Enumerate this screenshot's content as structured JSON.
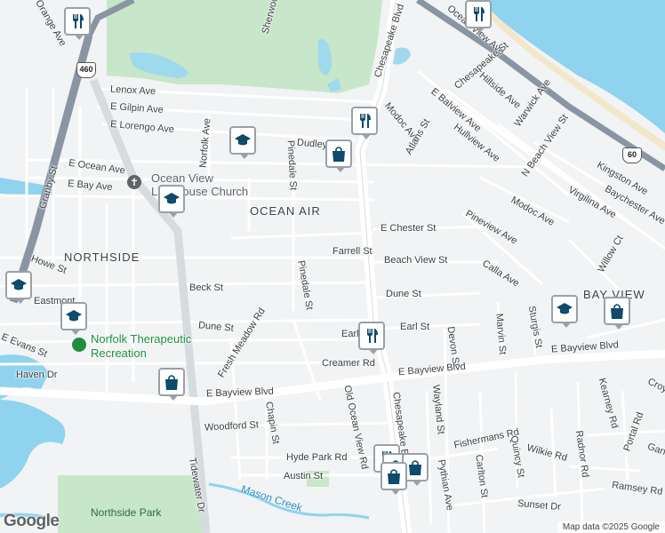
{
  "map": {
    "attribution": "Map data ©2025 Google",
    "logo": "Google",
    "colors": {
      "water": "#8fd3ee",
      "park": "#c8e6c9",
      "road": "#ffffff",
      "highway": "#8a95a3",
      "background": "#f1f3f4",
      "pin_icon": "#0d4a6b"
    }
  },
  "areas": {
    "ocean_air": "OCEAN AIR",
    "northside": "NORTHSIDE",
    "bay_view": "BAY VIEW"
  },
  "pois": {
    "church": "Ocean View Lighthouse Church",
    "church_line1": "Ocean View",
    "church_line2": "Lighthouse Church",
    "therapy_line1": "Norfolk Therapeutic",
    "therapy_line2": "Recreation",
    "park": "Northside Park",
    "creek": "Mason Creek"
  },
  "shields": {
    "us460": "460",
    "us60": "60"
  },
  "streets": {
    "orange": "Orange Ave",
    "sherwood": "Sherwood",
    "chesapeake_blvd_n": "Chesapeake Blvd",
    "ocean_view": "Ocean View Ave",
    "lenox": "Lenox Ave",
    "gilpin": "E Gilpin Ave",
    "lorengo": "E Lorengo Ave",
    "norfolk": "Norfolk Ave",
    "dudley": "Dudley",
    "pinedale_n": "Pinedale St",
    "granby": "Granby St",
    "e_ocean": "E Ocean Ave",
    "e_bay": "E Bay Ave",
    "chesapeake_st": "Chesapeake St",
    "hillside": "Hillside Ave",
    "warwick": "Warwick Ave",
    "e_balview": "E Balview Ave",
    "modoc_n": "Modoc Ave",
    "atlans": "Atlans St",
    "hullview": "Hullview Ave",
    "n_beach_view": "N Beach View St",
    "kingston": "Kingston Ave",
    "baychester": "Baychester Ave",
    "virgilina": "Virgilina Ave",
    "modoc_s": "Modoc Ave",
    "e_chester": "E Chester St",
    "pineview": "Pineview Ave",
    "willow": "Willow Ct",
    "farrell": "Farrell St",
    "beach_view": "Beach View St",
    "calla": "Calla Ave",
    "howe": "Howe St",
    "beck": "Beck St",
    "pinedale_s": "Pinedale St",
    "dune_e": "Dune St",
    "dune_w": "Dune St",
    "eastmont": "Eastmont",
    "earl": "Earl St",
    "earl_w": "Earl",
    "marvin": "Marvin St",
    "sturgis": "Sturgis St",
    "e_evans": "E Evans St",
    "fresh_meadow": "Fresh Meadow Rd",
    "creamer": "Creamer Rd",
    "devon": "Devon St",
    "e_bayview_e": "E Bayview Blvd",
    "e_bayview_m": "E Bayview Blvd",
    "e_bayview_w": "E Bayview Blvd",
    "haven": "Haven Dr",
    "chesapeake_blvd_s": "Chesapeake Blvd",
    "wayland": "Wayland St",
    "old_ocean_view": "Old Ocean View Rd",
    "chapin": "Chapin St",
    "woodford": "Woodford St",
    "tidewater": "Tidewater Dr",
    "hyde_park": "Hyde Park Rd",
    "austin": "Austin St",
    "pythian": "Pythian Ave",
    "fishermans": "Fishermans Rd",
    "carlton": "Carlton St",
    "quincy": "Quincy St",
    "wilkie": "Wilkie Rd",
    "radnor": "Radnor Rd",
    "portal": "Portal Rd",
    "kearney": "Kearney Rd",
    "ramsey": "Ramsey Rd",
    "sunset": "Sunset Dr",
    "croy": "Croy",
    "garf": "Garf"
  },
  "pins": [
    {
      "name": "restaurant-pin",
      "icon": "restaurant"
    },
    {
      "name": "restaurant-pin",
      "icon": "restaurant"
    },
    {
      "name": "restaurant-pin",
      "icon": "restaurant"
    },
    {
      "name": "restaurant-pin",
      "icon": "restaurant"
    },
    {
      "name": "restaurant-pin",
      "icon": "restaurant"
    },
    {
      "name": "school-pin",
      "icon": "school"
    },
    {
      "name": "school-pin",
      "icon": "school"
    },
    {
      "name": "school-pin",
      "icon": "school"
    },
    {
      "name": "school-pin",
      "icon": "school"
    },
    {
      "name": "school-pin",
      "icon": "school"
    },
    {
      "name": "shopping-pin",
      "icon": "shopping"
    },
    {
      "name": "shopping-pin",
      "icon": "shopping"
    },
    {
      "name": "shopping-pin",
      "icon": "shopping"
    },
    {
      "name": "shopping-pin",
      "icon": "shopping"
    },
    {
      "name": "shopping-pin",
      "icon": "shopping"
    },
    {
      "name": "shopping-pin",
      "icon": "shopping"
    }
  ]
}
